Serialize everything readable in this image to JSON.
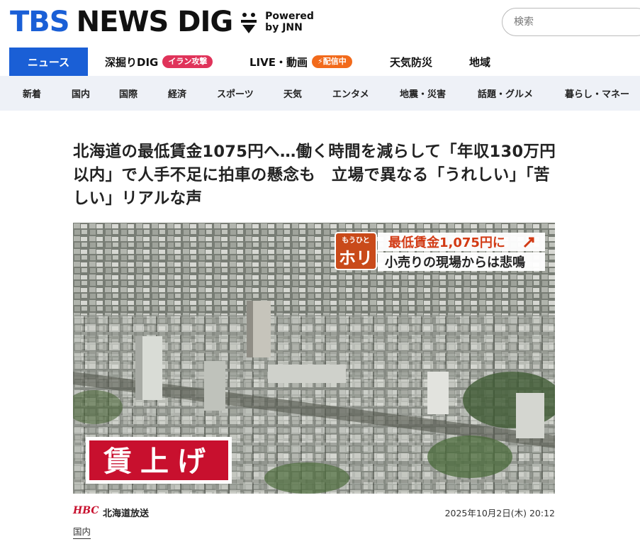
{
  "header": {
    "logo_tbs": "TBS",
    "logo_news": "NEWS DIG",
    "powered_line1": "Powered",
    "powered_line2": "by JNN",
    "search_placeholder": "検索"
  },
  "main_nav": {
    "items": [
      {
        "label": "ニュース",
        "active": true
      },
      {
        "label": "深掘りDIG",
        "badge": "イラン攻撃"
      },
      {
        "label": "LIVE・動画",
        "badge": "配信中"
      },
      {
        "label": "天気防災"
      },
      {
        "label": "地域"
      }
    ]
  },
  "sub_nav": {
    "items": [
      "新着",
      "国内",
      "国際",
      "経済",
      "スポーツ",
      "天気",
      "エンタメ",
      "地震・災害",
      "話題・グルメ",
      "暮らし・マネー"
    ]
  },
  "article": {
    "headline": "北海道の最低賃金1075円へ…働く時間を減らして「年収130万円以内」で人手不足に拍車の懸念も　立場で異なる「うれしい」「苦しい」リアルな声",
    "image": {
      "corner_tag_top": "もうひと",
      "corner_tag_big": "ホリ",
      "caption_main": "最低賃金1,075円に",
      "caption_sub": "小売りの現場からは悲鳴",
      "stamp": "賃上げ"
    },
    "source_logo": "HBC",
    "source_name": "北海道放送",
    "datetime": "2025年10月2日(木) 20:12",
    "category": "国内"
  },
  "colors": {
    "brand_blue": "#1a5fd6",
    "badge_red": "#e0335a",
    "badge_orange": "#f26a1b",
    "subnav_bg": "#eef1f7",
    "stamp_red": "#c8102e"
  }
}
